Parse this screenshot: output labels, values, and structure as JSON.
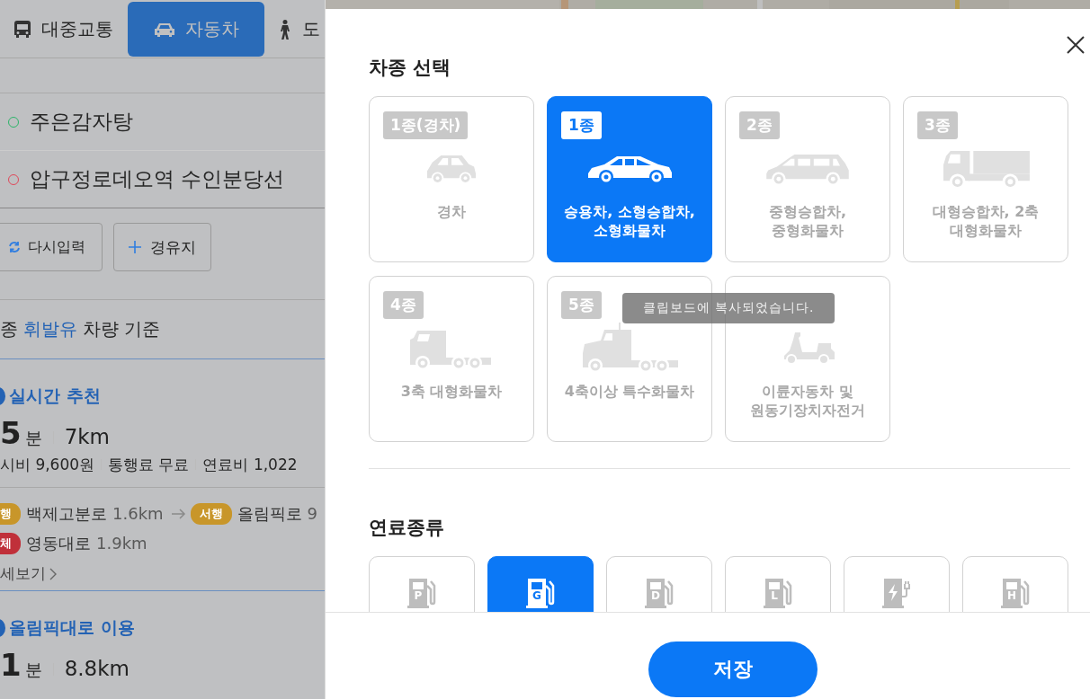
{
  "tabs": [
    {
      "label": "대중교통",
      "kind": "bus",
      "selected": false
    },
    {
      "label": "자동차",
      "kind": "car",
      "selected": true
    },
    {
      "label": "도",
      "kind": "walk",
      "selected": false
    }
  ],
  "origin": "주은감자탕",
  "destination": "압구정로데오역 수인분당선",
  "actions": [
    {
      "label": "다시입력",
      "kind": "refresh"
    },
    {
      "label": "경유지",
      "kind": "add"
    }
  ],
  "basis": {
    "prefix": "종",
    "fuel": "휘발유",
    "suffix": "차량 기준"
  },
  "routes": [
    {
      "title": "실시간 추천",
      "minutes": "5",
      "unit": "분",
      "distance": "7km",
      "costs": [
        "시비 9,600원",
        "통행료 무료",
        "연료비 1,022"
      ],
      "roads": [
        [
          {
            "badge": "행",
            "color": "#c8962a",
            "road": "백제고분로",
            "length": "1.6km"
          },
          {
            "badge": "서행",
            "color": "#c8962a",
            "road": "올림픽로",
            "length": "9"
          }
        ],
        [
          {
            "badge": "체",
            "color": "#c0303a",
            "road": "영동대로",
            "length": "1.9km"
          }
        ]
      ],
      "more": "세보기"
    },
    {
      "title": "올림픽대로 이용",
      "minutes": "1",
      "unit": "분",
      "distance": "8.8km"
    }
  ],
  "vehicle": {
    "title": "차종 선택",
    "types": [
      {
        "badge": "1종(경차)",
        "label": "경차",
        "kind": "compact",
        "selected": false
      },
      {
        "badge": "1종",
        "label": "승용차, 소형승합차,\n소형화물차",
        "kind": "sedan",
        "selected": true
      },
      {
        "badge": "2종",
        "label": "중형승합차,\n중형화물차",
        "kind": "van",
        "selected": false
      },
      {
        "badge": "3종",
        "label": "대형승합차, 2축\n대형화물차",
        "kind": "truck",
        "selected": false
      },
      {
        "badge": "4종",
        "label": "3축 대형화물차",
        "kind": "tractor",
        "selected": false
      },
      {
        "badge": "5종",
        "label": "4축이상 특수화물차",
        "kind": "semi",
        "selected": false
      },
      {
        "label": "이륜자동차 및\n원동기장치자전거",
        "kind": "scooter",
        "selected": false
      }
    ]
  },
  "fuel": {
    "title": "연료종류",
    "types": [
      {
        "letter": "P",
        "kind": "pump",
        "selected": false
      },
      {
        "letter": "G",
        "kind": "pump",
        "selected": true
      },
      {
        "letter": "D",
        "kind": "pump",
        "selected": false
      },
      {
        "letter": "L",
        "kind": "pump",
        "selected": false
      },
      {
        "kind": "charger",
        "selected": false
      },
      {
        "letter": "H",
        "kind": "pump",
        "selected": false
      }
    ]
  },
  "toast": "클립보드에 복사되었습니다.",
  "save": "저장"
}
